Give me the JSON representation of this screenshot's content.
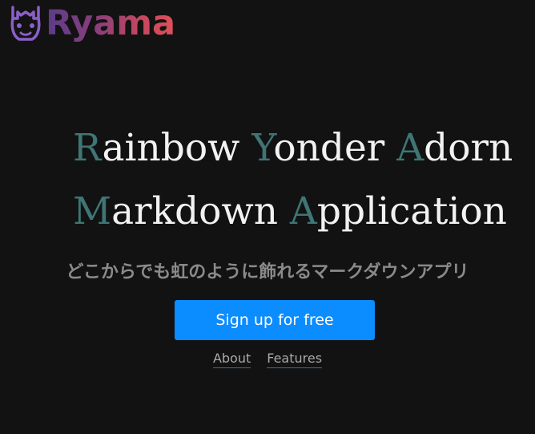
{
  "header": {
    "brand": "Ryama",
    "logo_icon": "llama-face-icon",
    "brand_gradient": [
      "#5b3c8a",
      "#c8475e"
    ]
  },
  "hero": {
    "line1": [
      {
        "cap": "R",
        "rest": "ainbow "
      },
      {
        "cap": "Y",
        "rest": "onder "
      },
      {
        "cap": "A",
        "rest": "dorn"
      }
    ],
    "line2": [
      {
        "cap": "M",
        "rest": "arkdown "
      },
      {
        "cap": "A",
        "rest": "pplication"
      }
    ],
    "subtitle": "どこからでも虹のように飾れるマークダウンアプリ",
    "accent_color": "#3f7575"
  },
  "cta": {
    "label": "Sign up for free",
    "color": "#0b8cff"
  },
  "links": {
    "about": "About",
    "features": "Features"
  }
}
